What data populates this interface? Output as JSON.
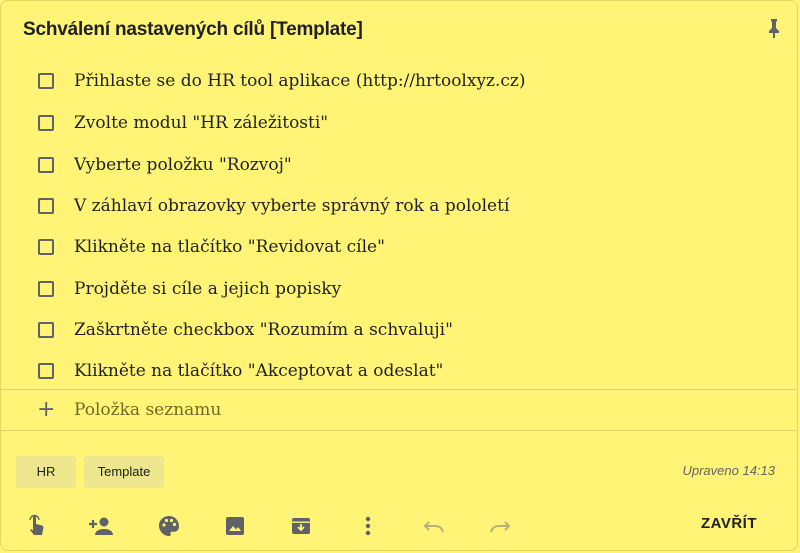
{
  "note": {
    "title": "Schválení nastavených cílů [Template]",
    "items": [
      {
        "label": "Přihlaste se do HR tool aplikace (http://hrtoolxyz.cz)",
        "checked": false
      },
      {
        "label": "Zvolte modul \"HR záležitosti\"",
        "checked": false
      },
      {
        "label": "Vyberte položku \"Rozvoj\"",
        "checked": false
      },
      {
        "label": "V záhlaví obrazovky vyberte správný rok a pololetí",
        "checked": false
      },
      {
        "label": "Klikněte na tlačítko \"Revidovat cíle\"",
        "checked": false
      },
      {
        "label": "Projděte si cíle a jejich popisky",
        "checked": false
      },
      {
        "label": "Zaškrtněte checkbox \"Rozumím a schvaluji\"",
        "checked": false
      },
      {
        "label": "Klikněte na tlačítko \"Akceptovat a odeslat\"",
        "checked": false
      }
    ],
    "add_item_placeholder": "Položka seznamu",
    "add_icon": "+",
    "labels": [
      "HR",
      "Template"
    ],
    "edited": "Upraveno 14:13",
    "close_label": "ZAVŘÍT"
  },
  "colors": {
    "background": "#fff475",
    "chip": "#eee68c",
    "icon": "#5f6368"
  },
  "toolbar_icons": [
    "remind-me-icon",
    "collaborator-icon",
    "palette-icon",
    "image-icon",
    "archive-icon",
    "more-icon",
    "undo-icon",
    "redo-icon"
  ]
}
